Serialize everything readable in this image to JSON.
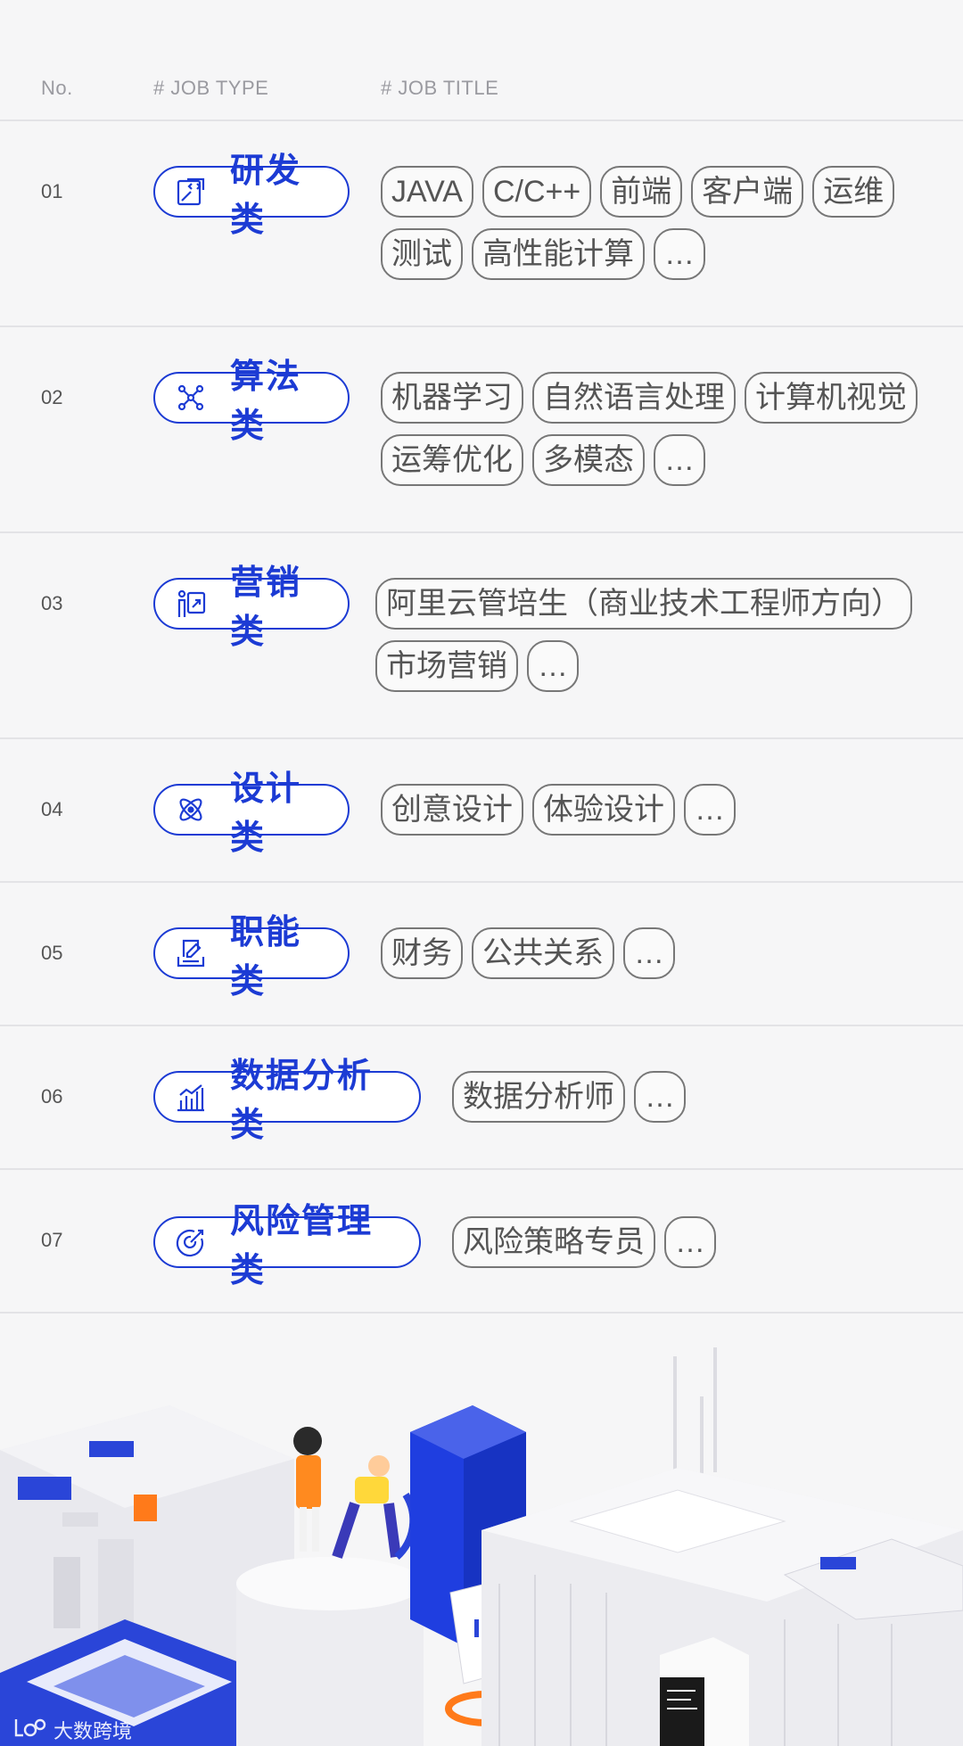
{
  "header": {
    "col_no": "No.",
    "col_type": "# JOB TYPE",
    "col_title": "# JOB TITLE"
  },
  "rows": [
    {
      "no": "01",
      "type": "研发类",
      "icon": "code-edit-icon",
      "tags": [
        "JAVA",
        "C/C++",
        "前端",
        "客户端",
        "运维",
        "测试",
        "高性能计算",
        "…"
      ]
    },
    {
      "no": "02",
      "type": "算法类",
      "icon": "network-icon",
      "tags": [
        "机器学习",
        "自然语言处理",
        "计算机视觉",
        "运筹优化",
        "多模态",
        "…"
      ]
    },
    {
      "no": "03",
      "type": "营销类",
      "icon": "presenter-icon",
      "tags": [
        "阿里云管培生（商业技术工程师方向）",
        "市场营销",
        "…"
      ]
    },
    {
      "no": "04",
      "type": "设计类",
      "icon": "atom-icon",
      "tags": [
        "创意设计",
        "体验设计",
        "…"
      ]
    },
    {
      "no": "05",
      "type": "职能类",
      "icon": "document-pen-icon",
      "tags": [
        "财务",
        "公共关系",
        "…"
      ]
    },
    {
      "no": "06",
      "type": "数据分析类",
      "icon": "bar-chart-icon",
      "tags": [
        "数据分析师",
        "…"
      ]
    },
    {
      "no": "07",
      "type": "风险管理类",
      "icon": "target-icon",
      "tags": [
        "风险策略专员",
        "…"
      ]
    }
  ],
  "watermark": "大数跨境",
  "colors": {
    "accent": "#1c3bd4",
    "background": "#f6f6f7",
    "divider": "#e3e3e6"
  }
}
